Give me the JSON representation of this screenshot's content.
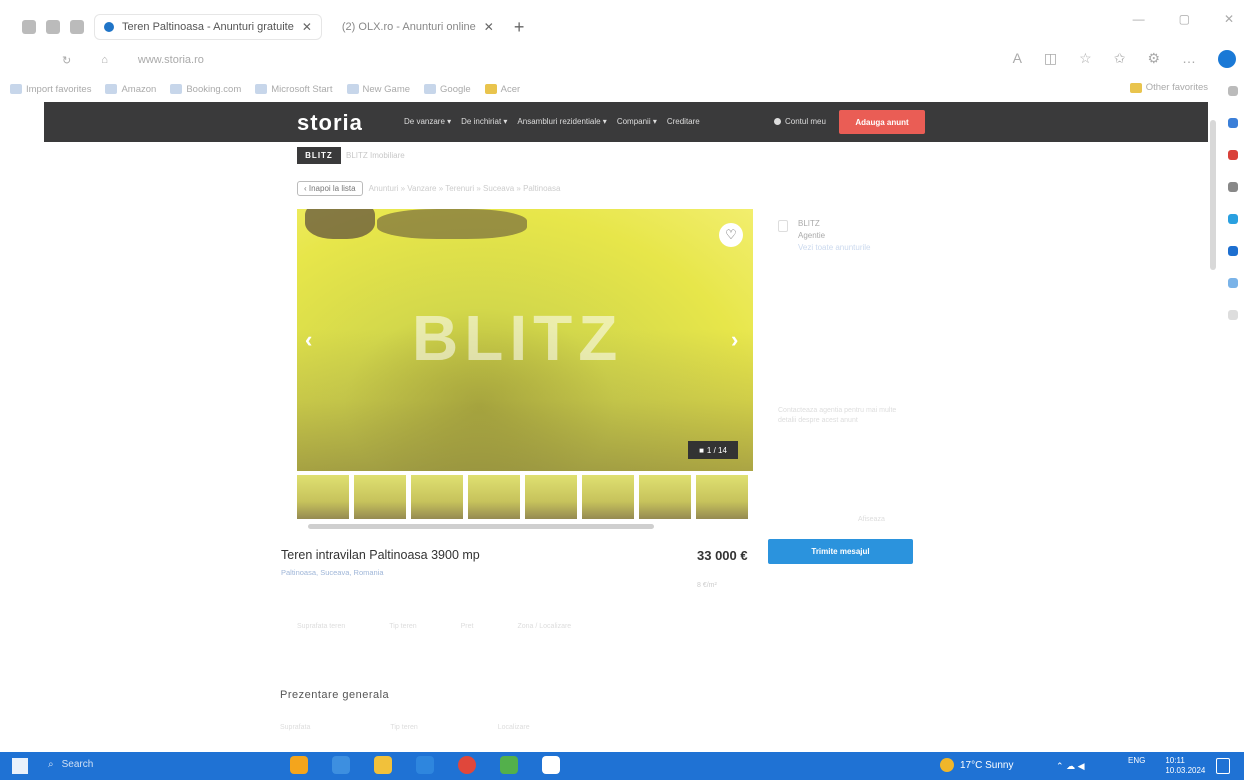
{
  "browser": {
    "tabs": [
      {
        "label": "Teren Paltinoasa - Anunturi gratuite",
        "active": true
      },
      {
        "label": "(2) OLX.ro - Anunturi online",
        "active": false
      }
    ],
    "new_tab_icon": "plus-icon",
    "url": "www.storia.ro",
    "bookmarks": [
      {
        "label": "Import favorites",
        "icon": "import-icon"
      },
      {
        "label": "Amazon",
        "icon": "amazon-icon"
      },
      {
        "label": "Booking.com",
        "icon": "booking-icon"
      },
      {
        "label": "Microsoft Start",
        "icon": "news-icon"
      },
      {
        "label": "New Game",
        "icon": "game-icon"
      },
      {
        "label": "Google",
        "icon": "google-icon"
      },
      {
        "label": "Acer",
        "icon": "folder-icon"
      }
    ],
    "other_favorites": "Other favorites"
  },
  "site": {
    "logo": "storia",
    "nav": [
      "De vanzare ▾",
      "De inchiriat ▾",
      "Ansambluri rezidentiale ▾",
      "Companii ▾",
      "Creditare"
    ],
    "account": "Contul meu",
    "add_listing": "Adauga anunt"
  },
  "agency": {
    "badge": "BLITZ",
    "name": "BLITZ Imobiliare"
  },
  "breadcrumb": {
    "back": "‹ Inapoi la lista",
    "path": "Anunturi » Vanzare » Terenuri » Suceava » Paltinoasa"
  },
  "gallery": {
    "watermark": "BLITZ",
    "counter": "1 / 14",
    "prev_icon": "chevron-left-icon",
    "next_icon": "chevron-right-icon",
    "favorite_icon": "heart-icon",
    "thumb_count": 8
  },
  "listing": {
    "title": "Teren intravilan  Paltinoasa  3900 mp",
    "location": "Paltinoasa, Suceava, Romania",
    "price": "33 000 €",
    "price_per_m2": "8 €/m²",
    "message_button": "Trimite mesajul"
  },
  "sidebar": {
    "agent_name": "BLITZ",
    "agent_role": "Agentie",
    "agent_link": "Vezi toate anunturile",
    "note": "Contacteaza agentia pentru mai multe detalii despre acest anunt",
    "phone_label": "Afiseaza"
  },
  "attributes": [
    "Suprafata teren",
    "Tip teren",
    "Pret",
    "Zona / Localizare"
  ],
  "section": {
    "title": "Prezentare generala",
    "row": [
      "Suprafata",
      "Tip teren",
      "Localizare"
    ]
  },
  "taskbar": {
    "search": "Search",
    "weather": "17°C  Sunny",
    "lang": "ENG",
    "time": "10:11",
    "date": "10.03.2024"
  },
  "colors": {
    "nav_bg": "#3a3a3b",
    "add_button": "#ea5d55",
    "message_button": "#2b93dd",
    "taskbar": "#1f72d4"
  }
}
